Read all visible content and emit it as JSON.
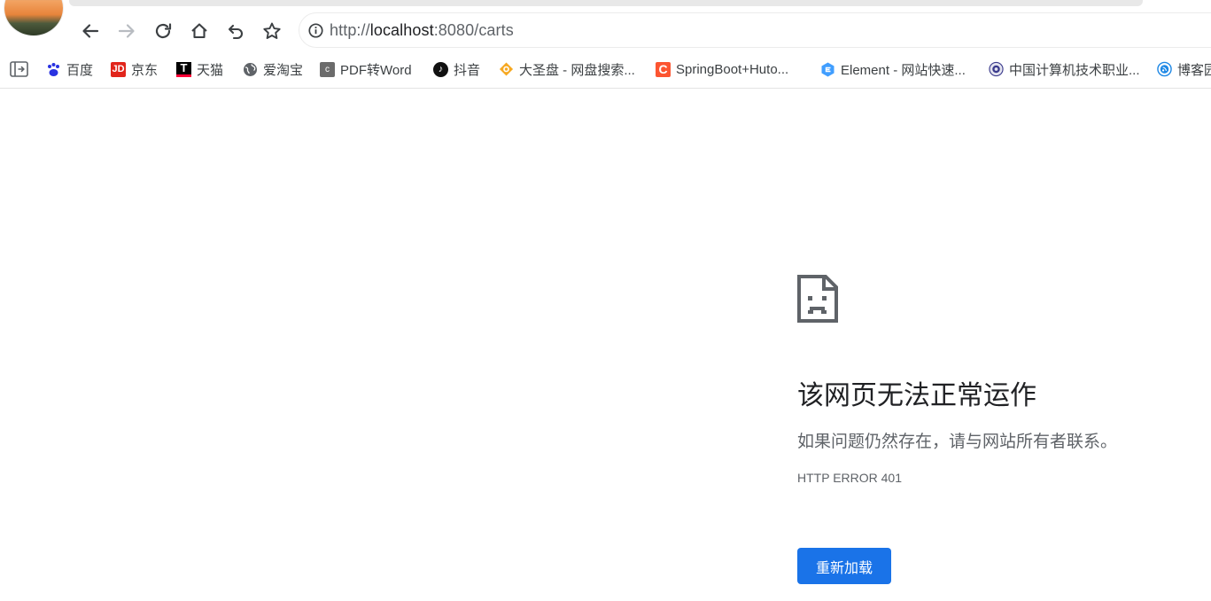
{
  "browser": {
    "url_scheme": "http://",
    "url_host": "localhost",
    "url_rest": ":8080/carts"
  },
  "bookmarks": [
    {
      "label": "百度",
      "icon": "baidu-paw-icon",
      "color": "#2932e1"
    },
    {
      "label": "京东",
      "icon": "jd-icon",
      "color": "#e1251b",
      "glyph": "JD"
    },
    {
      "label": "天猫",
      "icon": "tmall-icon",
      "color": "#ff0036",
      "glyph": "T"
    },
    {
      "label": "爱淘宝",
      "icon": "globe-icon",
      "color": "#5f6368"
    },
    {
      "label": "PDF转Word",
      "icon": "pdf-c-icon",
      "color": "#666666",
      "glyph": "c"
    },
    {
      "label": "抖音",
      "icon": "douyin-icon",
      "color": "#111111",
      "glyph": "♪"
    },
    {
      "label": "大圣盘 - 网盘搜索...",
      "icon": "dashengpan-icon",
      "color": "#f6a821"
    },
    {
      "label": "SpringBoot+Huto...",
      "icon": "csdn-c-icon",
      "color": "#fc5531",
      "glyph": "C"
    },
    {
      "label": "Element - 网站快速...",
      "icon": "element-icon",
      "color": "#409eff"
    },
    {
      "label": "中国计算机技术职业...",
      "icon": "ceac-seal-icon",
      "color": "#3a3a8c"
    },
    {
      "label": "博客园",
      "icon": "cnblogs-icon",
      "color": "#1e88e5"
    }
  ],
  "error": {
    "title": "该网页无法正常运作",
    "message": "如果问题仍然存在，请与网站所有者联系。",
    "code": "HTTP ERROR 401",
    "reload_label": "重新加载",
    "button_color": "#1a73e8"
  }
}
